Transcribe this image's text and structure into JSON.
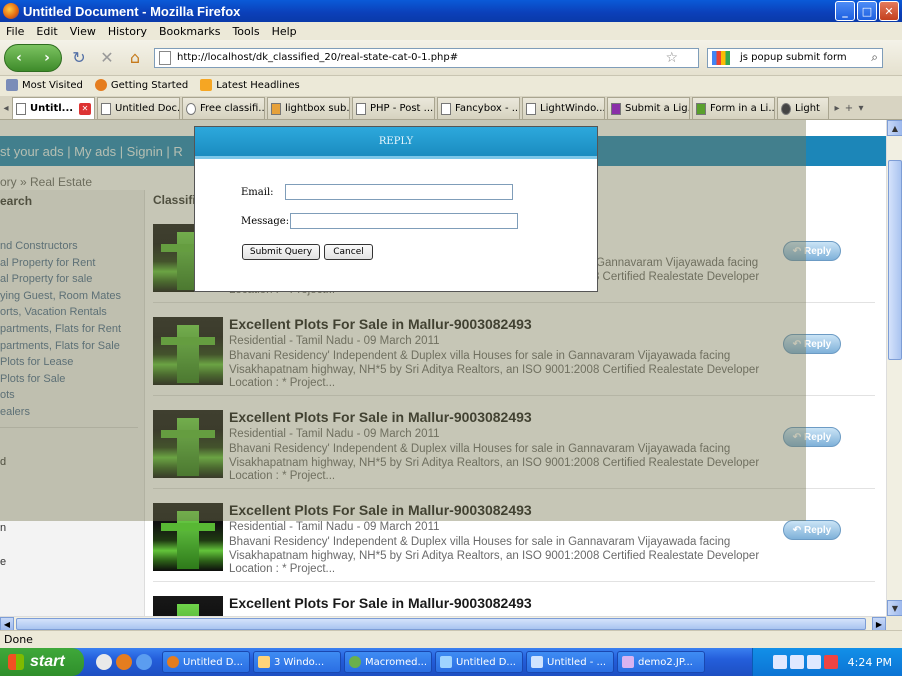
{
  "window": {
    "title": "Untitled Document - Mozilla Firefox"
  },
  "menu": [
    "File",
    "Edit",
    "View",
    "History",
    "Bookmarks",
    "Tools",
    "Help"
  ],
  "nav": {
    "url": "http://localhost/dk_classified_20/real-state-cat-0-1.php#",
    "search_value": "js popup submit form"
  },
  "bookmarks": [
    "Most Visited",
    "Getting Started",
    "Latest Headlines"
  ],
  "tabs": [
    "Untitl...",
    "Untitled Doc...",
    "Free classifi...",
    "lightbox sub...",
    "PHP - Post ...",
    "Fancybox - ...",
    "LightWindo...",
    "Submit a Lig...",
    "Form in a Li...",
    "Light"
  ],
  "site": {
    "topnav": "st your ads  |  My ads  |  Signin  |  R",
    "breadcrumb": "ory » Real Estate",
    "sidebar_heading": "earch",
    "sidebar_items": [
      "nd Constructors",
      "al Property for Rent",
      "al Property for sale",
      "ying Guest, Room Mates",
      "orts, Vacation Rentals",
      "partments, Flats for Rent",
      "partments, Flats for Sale",
      "Plots for Lease",
      "Plots for Sale",
      "ots",
      "ealers"
    ],
    "sidebar_extra": [
      "d",
      "n",
      "e"
    ],
    "list_heading": "Classifi",
    "reply_label": "Reply",
    "listings": [
      {
        "title": "",
        "meta": "",
        "desc": "Visakhapatnam highway, NH*5 by Sri Aditya Realtors, an ISO 9001:2008 Certified Realestate Developer",
        "desc_top": "Gannavaram Vijayawada facing",
        "loc": "Location : * Project..."
      },
      {
        "title": "Excellent Plots For Sale in Mallur-9003082493",
        "meta": "Residential - Tamil Nadu - 09 March 2011",
        "desc": "Bhavani Residency' Independent & Duplex villa Houses for sale in Gannavaram Vijayawada facing Visakhapatnam highway, NH*5 by Sri Aditya Realtors, an ISO 9001:2008 Certified Realestate Developer",
        "loc": "Location : * Project..."
      },
      {
        "title": "Excellent Plots For Sale in Mallur-9003082493",
        "meta": "Residential - Tamil Nadu - 09 March 2011",
        "desc": "Bhavani Residency' Independent & Duplex villa Houses for sale in Gannavaram Vijayawada facing Visakhapatnam highway, NH*5 by Sri Aditya Realtors, an ISO 9001:2008 Certified Realestate Developer",
        "loc": "Location : * Project..."
      },
      {
        "title": "Excellent Plots For Sale in Mallur-9003082493",
        "meta": "Residential - Tamil Nadu - 09 March 2011",
        "desc": "Bhavani Residency' Independent & Duplex villa Houses for sale in Gannavaram Vijayawada facing Visakhapatnam highway, NH*5 by Sri Aditya Realtors, an ISO 9001:2008 Certified Realestate Developer",
        "loc": "Location : * Project..."
      },
      {
        "title": "Excellent Plots For Sale in Mallur-9003082493",
        "meta": "",
        "desc": "",
        "loc": ""
      }
    ]
  },
  "modal": {
    "title": "REPLY",
    "email_label": "Email:",
    "message_label": "Message:",
    "submit_label": "Submit Query",
    "cancel_label": "Cancel"
  },
  "status": {
    "text": "Done"
  },
  "taskbar": {
    "start_label": "start",
    "tasks": [
      "Untitled D...",
      "3 Windo...",
      "Macromed...",
      "Untitled D...",
      "Untitled - ...",
      "demo2.JP..."
    ],
    "clock": "4:24 PM"
  },
  "colors": {
    "site_header": "#1c86b8",
    "modal_header": "#2da8dc",
    "titlebar": "#0b3fb8"
  }
}
